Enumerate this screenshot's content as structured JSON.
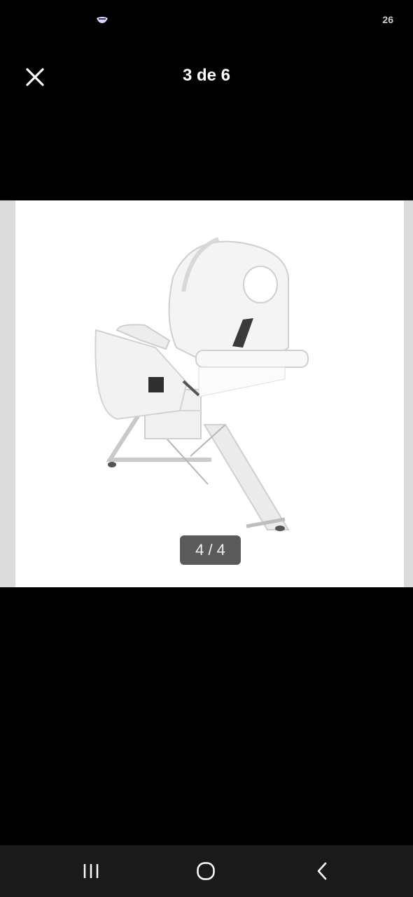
{
  "status": {
    "notification_count": "26",
    "icon": "app-notification-icon"
  },
  "viewer": {
    "title": "3 de 6",
    "close_icon": "close-icon"
  },
  "photo": {
    "subject": "white-salon-chair",
    "position_badge": "4 / 4"
  },
  "nav": {
    "recents_icon": "recents-icon",
    "home_icon": "home-icon",
    "back_icon": "back-icon"
  },
  "colors": {
    "background": "#000000",
    "nav_bar": "#1a1a1a",
    "badge": "#5a5a5a"
  }
}
